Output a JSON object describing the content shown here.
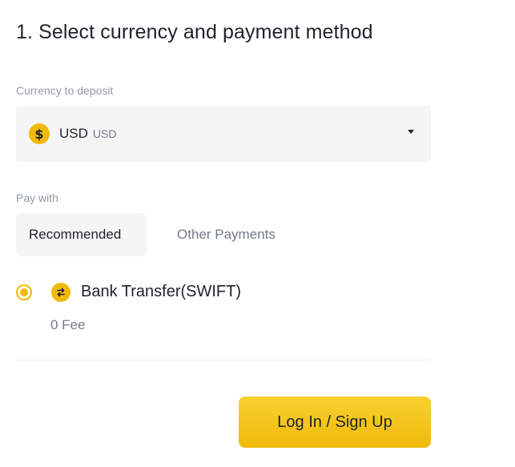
{
  "page": {
    "title": "1. Select currency and payment method"
  },
  "currency": {
    "label": "Currency to deposit",
    "selected_code": "USD",
    "selected_sub": "USD",
    "icon": "dollar-coin-icon",
    "icon_glyph": "$",
    "icon_color": "#f0b90b"
  },
  "pay_with": {
    "label": "Pay with",
    "tabs": [
      {
        "label": "Recommended",
        "active": true
      },
      {
        "label": "Other Payments",
        "active": false
      }
    ]
  },
  "methods": [
    {
      "name": "Bank Transfer(SWIFT)",
      "fee": "0 Fee",
      "selected": true,
      "icon": "bank-transfer-icon"
    }
  ],
  "actions": {
    "login_label": "Log In / Sign Up"
  },
  "colors": {
    "accent": "#f0b90b",
    "text_primary": "#1e2329",
    "text_secondary": "#707a8a",
    "text_muted": "#929aa5",
    "surface": "#f5f5f5"
  }
}
